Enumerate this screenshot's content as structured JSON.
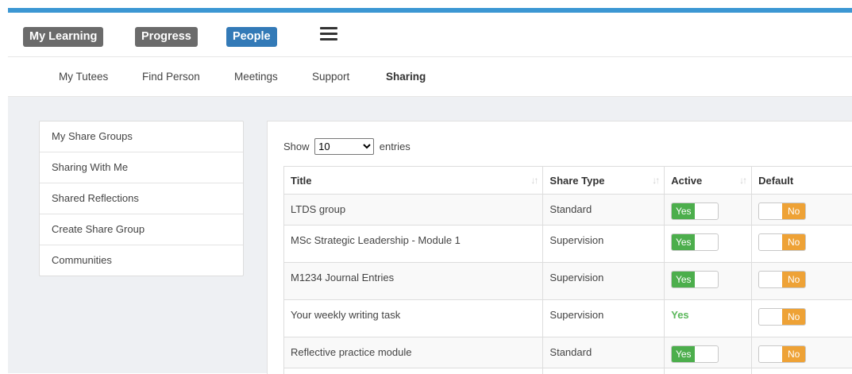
{
  "topnav": {
    "items": [
      {
        "label": "My Learning",
        "active": false
      },
      {
        "label": "Progress",
        "active": false
      },
      {
        "label": "People",
        "active": true
      }
    ],
    "menu_icon": "hamburger-menu-icon",
    "accent_color": "#3c97d3",
    "active_color": "#337ab7",
    "inactive_color": "#6b6b6b"
  },
  "subnav": {
    "items": [
      {
        "label": "My Tutees"
      },
      {
        "label": "Find Person"
      },
      {
        "label": "Meetings"
      },
      {
        "label": "Support"
      },
      {
        "label": "Sharing",
        "active": true
      }
    ]
  },
  "sidebar": {
    "items": [
      {
        "label": "My Share Groups"
      },
      {
        "label": "Sharing With Me"
      },
      {
        "label": "Shared Reflections"
      },
      {
        "label": "Create Share Group"
      },
      {
        "label": "Communities"
      }
    ]
  },
  "table": {
    "show_label": "Show",
    "entries_label": "entries",
    "page_size": "10",
    "page_size_options": [
      "10"
    ],
    "sort_icon": "sort-arrows-icon",
    "columns": [
      "Title",
      "Share Type",
      "Active",
      "Default"
    ],
    "rows": [
      {
        "title": "LTDS group",
        "share_type": "Standard",
        "active": "Yes",
        "active_style": "toggle",
        "default": "No"
      },
      {
        "title": "MSc Strategic Leadership - Module 1",
        "share_type": "Supervision",
        "active": "Yes",
        "active_style": "toggle",
        "default": "No"
      },
      {
        "title": "M1234 Journal Entries",
        "share_type": "Supervision",
        "active": "Yes",
        "active_style": "toggle",
        "default": "No"
      },
      {
        "title": "Your weekly writing task",
        "share_type": "Supervision",
        "active": "Yes",
        "active_style": "text",
        "default": "No"
      },
      {
        "title": "Reflective practice module",
        "share_type": "Standard",
        "active": "Yes",
        "active_style": "toggle",
        "default": "No"
      }
    ],
    "yes_color": "#4cae4c",
    "no_color": "#eea236"
  }
}
